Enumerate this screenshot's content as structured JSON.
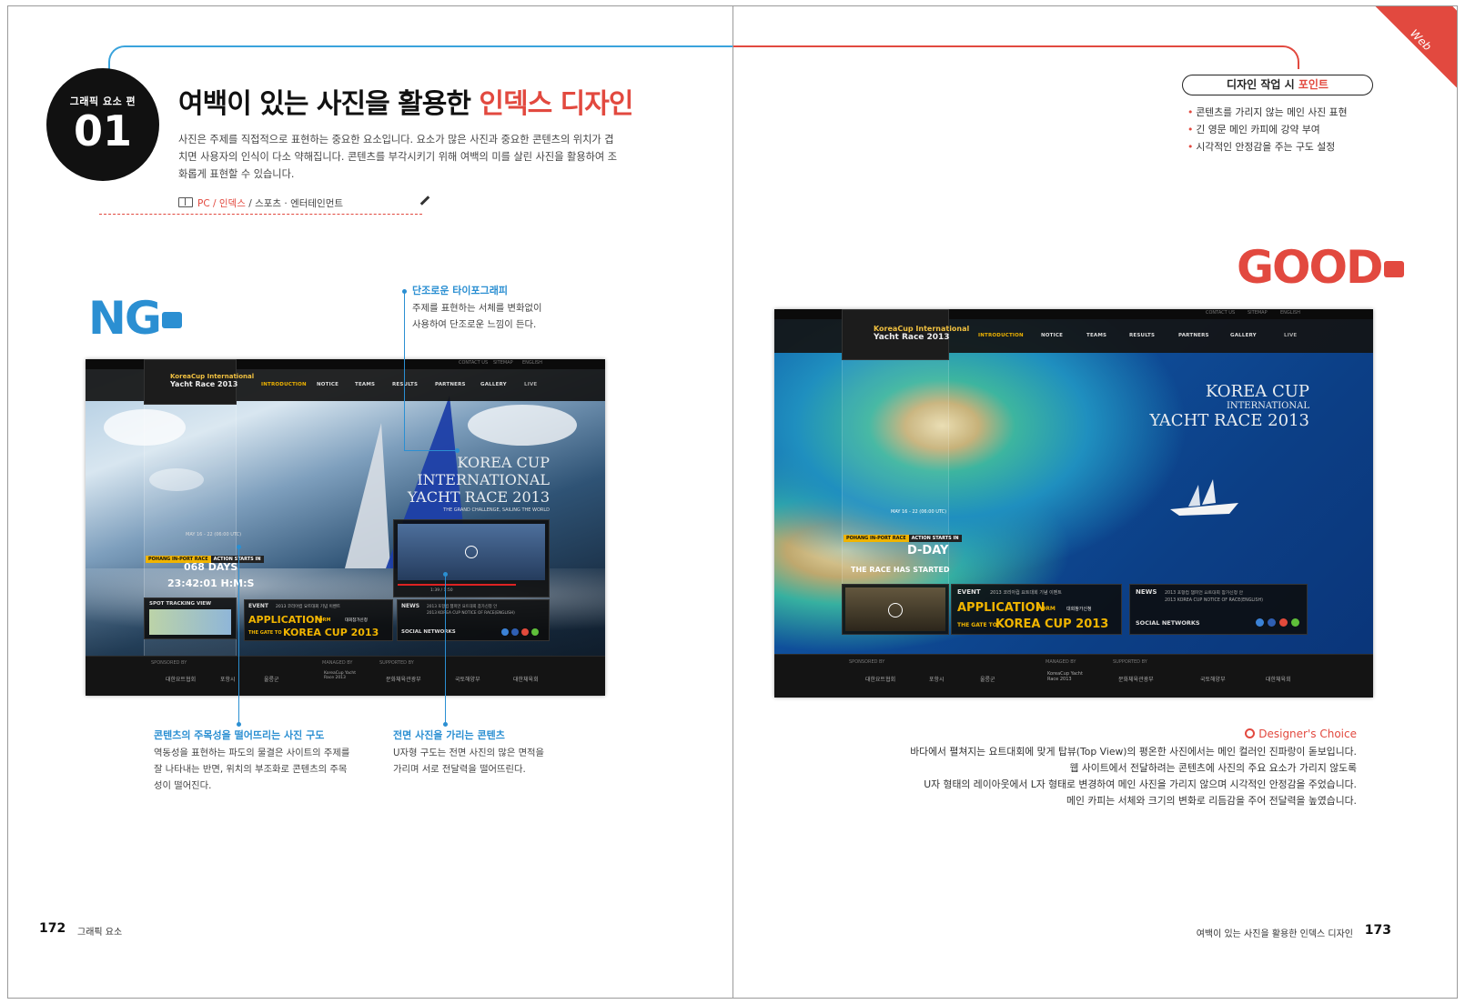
{
  "left_page": {
    "badge_caption": "그래픽 요소 편",
    "badge_number": "01",
    "title_main": "여백이 있는 사진을 활용한 ",
    "title_accent": "인덱스 디자인",
    "intro_lines": [
      "사진은 주제를 직접적으로 표현하는 중요한 요소입니다. 요소가 많은 사진과 중요한 콘텐츠의 위치가 겹",
      "치면 사용자의 인식이 다소 약해집니다. 콘텐츠를 부각시키기 위해 여백의 미를 살린 사진을 활용하여 조",
      "화롭게 표현할 수 있습니다."
    ],
    "crumb": {
      "a": "PC",
      "sep": " / ",
      "b": "인덱스",
      "c": "스포츠 · 엔터테인먼트"
    },
    "ng_label": "NG",
    "annotations": [
      {
        "title": "단조로운 타이포그래피",
        "lines": [
          "주제를 표현하는 서체를 변화없이",
          "사용하여 단조로운 느낌이 든다."
        ]
      },
      {
        "title": "콘텐츠의 주목성을 떨어뜨리는 사진 구도",
        "lines": [
          "역동성을 표현하는 파도의 물결은 사이트의 주제를",
          "잘 나타내는 반면, 위치의 부조화로 콘텐츠의 주목",
          "성이 떨어진다."
        ]
      },
      {
        "title": "전면 사진을 가리는 콘텐츠",
        "lines": [
          "U자형 구도는 전면 사진의 많은 면적을",
          "가리며 서로 전달력을 떨어뜨린다."
        ]
      }
    ],
    "page_number": "172",
    "page_name": "그래픽 요소"
  },
  "right_page": {
    "corner_label": "Web",
    "point_title": "디자인 작업 시 ",
    "point_accent": "포인트",
    "points": [
      "콘텐츠를 가리지 않는 메인 사진 표현",
      "긴 영문 메인 카피에 강약 부여",
      "시각적인 안정감을 주는 구도 설정"
    ],
    "good_label": "GOOD",
    "choice_label": "Designer's Choice",
    "choice_lines": [
      "바다에서 펼쳐지는 요트대회에 맞게 탑뷰(Top View)의 평온한 사진에서는 메인 컬러인 진파랑이 돋보입니다.",
      "웹 사이트에서 전달하려는 콘텐츠에 사진의 주요 요소가 가리지 않도록",
      "U자 형태의 레이아웃에서 L자 형태로 변경하여 메인 사진을 가리지 않으며 시각적인 안정감을 주었습니다.",
      "메인 카피는 서체와 크기의 변화로 리듬감을 주어 전달력을 높였습니다."
    ],
    "page_name": "여백이 있는 사진을 활용한 인덱스 디자인",
    "page_number": "173"
  },
  "site": {
    "util": [
      "CONTACT US",
      "SITEMAP",
      "ENGLISH"
    ],
    "logo_l1": "KoreaCup International",
    "logo_l2": "Yacht Race 2013",
    "menu": [
      "INTRODUCTION",
      "NOTICE",
      "TEAMS",
      "RESULTS",
      "PARTNERS",
      "GALLERY"
    ],
    "live": "LIVE",
    "ng_hero": [
      "KOREA CUP",
      "INTERNATIONAL",
      "YACHT RACE 2013"
    ],
    "ng_tagline": "THE GRAND CHALLENGE, SAILING THE WORLD",
    "good_hero": [
      "KOREA CUP",
      "INTERNATIONAL",
      "YACHT RACE 2013"
    ],
    "date": "MAY 16 - 22 (06:00 UTC)",
    "chip1": "POHANG IN-PORT RACE",
    "chip2": "ACTION STARTS IN",
    "days": "068 DAYS",
    "clock": "23:42:01 H:M:S",
    "tracking": "SPOT TRACKING VIEW",
    "dday": "D-DAY",
    "started": "THE RACE HAS STARTED",
    "event": "EVENT",
    "event_text": "2013 코리아컵 요트대회 기념 이벤트",
    "application": "APPLICATION",
    "application_form": "FORM",
    "application_ko": "대회참가신청",
    "gate": "THE GATE TO",
    "koreacup": "KOREA CUP 2013",
    "news": "NEWS",
    "news1": "2013 포항컵 챔피언 요트대회 참가신청 안",
    "news2": "2013 KOREA CUP NOTICE OF RACE(ENGLISH)",
    "social": "SOCIAL NETWORKS",
    "video_time": "1:39 / 1:50",
    "sponsored": "SPONSORED BY",
    "managed": "MANAGED BY",
    "supported": "SUPPORTED BY",
    "sponsors": [
      "대한요트협회",
      "포항시",
      "울릉군",
      "KoreaCup Yacht Race 2013",
      "문화체육관광부",
      "국토해양부",
      "대한체육회"
    ]
  },
  "colors": {
    "blue": "#2b8fd2",
    "red": "#e2493f",
    "yellow": "#f0b400"
  }
}
